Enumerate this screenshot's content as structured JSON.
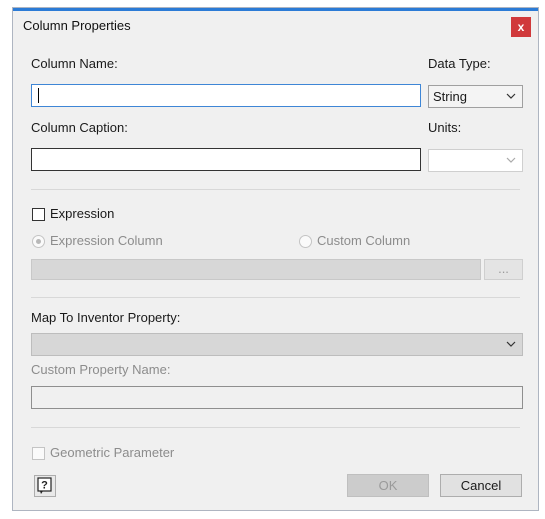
{
  "window": {
    "title": "Column Properties",
    "close_glyph": "x"
  },
  "column_name": {
    "label": "Column Name:",
    "value": ""
  },
  "data_type": {
    "label": "Data Type:",
    "selected": "String"
  },
  "column_caption": {
    "label": "Column Caption:",
    "value": ""
  },
  "units": {
    "label": "Units:",
    "selected": ""
  },
  "expression": {
    "checkbox_label": "Expression",
    "radio_expression_label": "Expression Column",
    "radio_custom_label": "Custom Column",
    "browse_label": "...",
    "value": ""
  },
  "map_to_inventor": {
    "label": "Map To Inventor Property:",
    "selected": ""
  },
  "custom_property": {
    "label": "Custom Property Name:",
    "value": ""
  },
  "geometric_parameter": {
    "label": "Geometric Parameter"
  },
  "buttons": {
    "ok": "OK",
    "cancel": "Cancel",
    "help_icon": "help-icon"
  },
  "colors": {
    "accent": "#2b7bd6",
    "close": "#d0393b"
  }
}
